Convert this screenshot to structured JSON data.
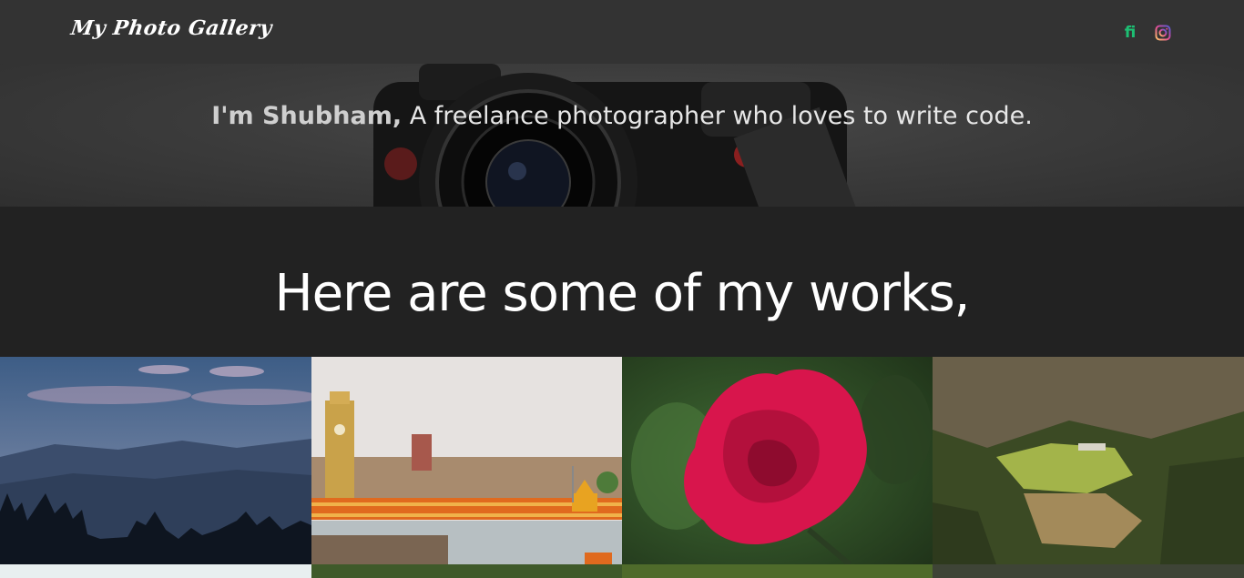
{
  "navbar": {
    "brand": "My Photo Gallery",
    "social": [
      {
        "name": "fiverr",
        "glyph": "fi",
        "color": "#1dbf73"
      },
      {
        "name": "instagram",
        "glyph": "instagram-icon"
      }
    ]
  },
  "hero": {
    "name_part": "I'm Shubham,",
    "tagline": "A freelance photographer who loves to write code."
  },
  "works": {
    "title": "Here are some of my works,"
  },
  "gallery": {
    "photos": [
      {
        "subject": "mountains-with-trees"
      },
      {
        "subject": "haridwar-ghat"
      },
      {
        "subject": "red-flower"
      },
      {
        "subject": "green-valley"
      }
    ]
  }
}
